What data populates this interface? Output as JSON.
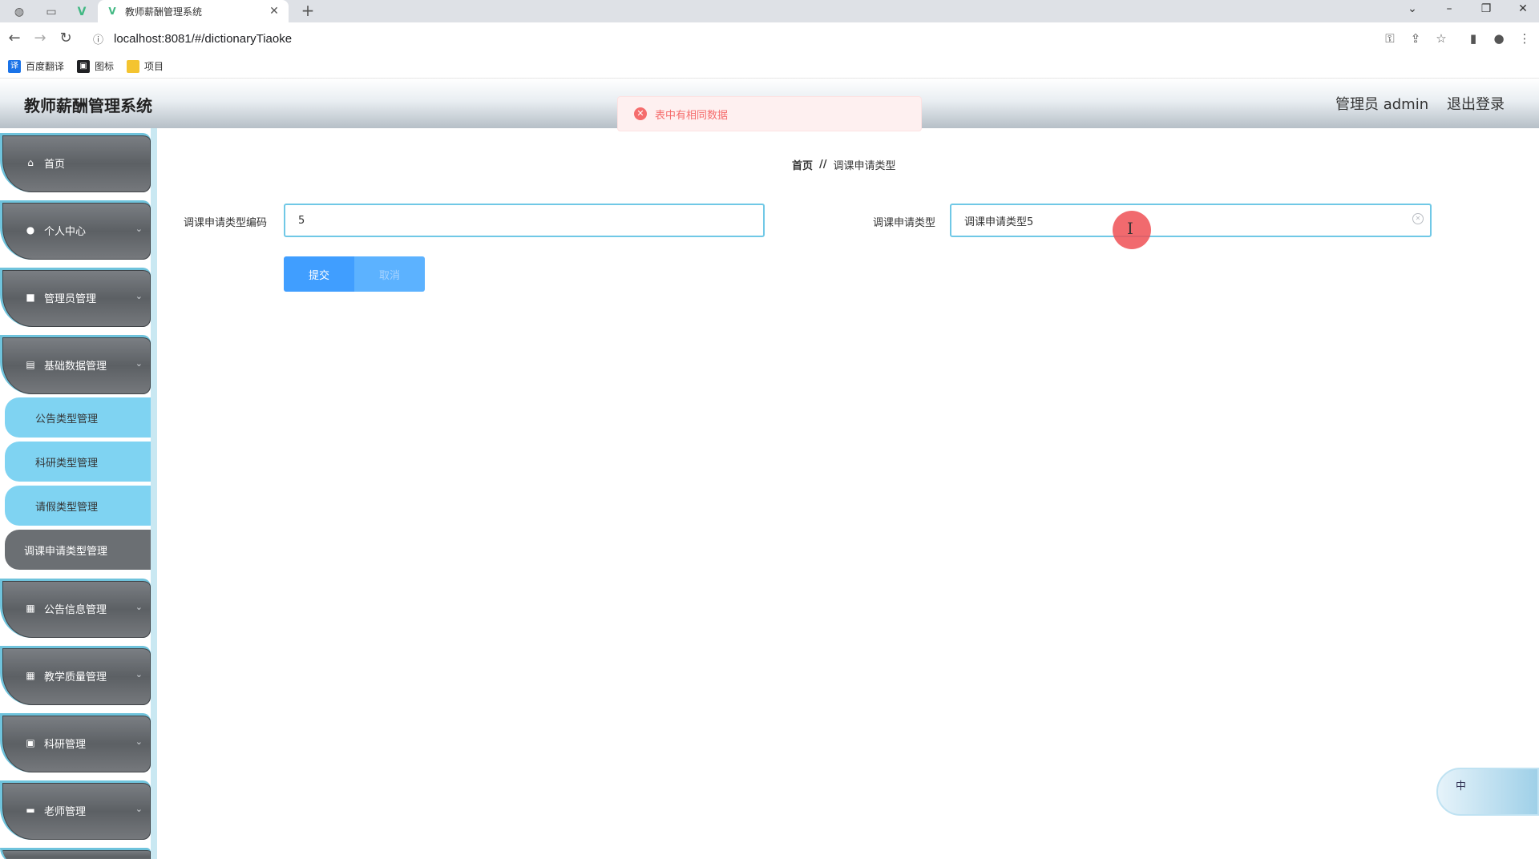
{
  "browser": {
    "tab_title": "教师薪酬管理系统",
    "url": "localhost:8081/#/dictionaryTiaoke",
    "bookmarks": [
      {
        "label": "百度翻译",
        "icon": "translate-icon",
        "color": "#1a73e8"
      },
      {
        "label": "图标",
        "icon": "image-icon",
        "color": "#202124"
      },
      {
        "label": "项目",
        "icon": "folder-icon",
        "color": "#f4c430"
      }
    ]
  },
  "header": {
    "title": "教师薪酬管理系统",
    "user": "管理员 admin",
    "logout": "退出登录"
  },
  "toast": {
    "type": "error",
    "message": "表中有相同数据",
    "color": "#f56c6c"
  },
  "sidebar": {
    "items": [
      {
        "label": "首页",
        "icon": "home-icon",
        "expandable": false
      },
      {
        "label": "个人中心",
        "icon": "user-icon",
        "expandable": true
      },
      {
        "label": "管理员管理",
        "icon": "briefcase-icon",
        "expandable": true
      },
      {
        "label": "基础数据管理",
        "icon": "clipboard-icon",
        "expandable": true,
        "children": [
          {
            "label": "公告类型管理",
            "active": false
          },
          {
            "label": "科研类型管理",
            "active": false
          },
          {
            "label": "请假类型管理",
            "active": false
          },
          {
            "label": "调课申请类型管理",
            "active": true
          }
        ]
      },
      {
        "label": "公告信息管理",
        "icon": "grid-icon",
        "expandable": true
      },
      {
        "label": "教学质量管理",
        "icon": "grid-icon",
        "expandable": true
      },
      {
        "label": "科研管理",
        "icon": "document-icon",
        "expandable": true
      },
      {
        "label": "老师管理",
        "icon": "monitor-icon",
        "expandable": true
      }
    ]
  },
  "breadcrumb": {
    "home": "首页",
    "separator": "//",
    "current": "调课申请类型"
  },
  "form": {
    "code_label": "调课申请类型编码",
    "code_value": "5",
    "type_label": "调课申请类型",
    "type_value": "调课申请类型5",
    "submit": "提交",
    "cancel": "取消"
  },
  "ime": {
    "label": "中"
  },
  "colors": {
    "accent": "#409eff",
    "sidebar_submenu": "#7fd3f2",
    "input_border": "#70c8e6"
  }
}
